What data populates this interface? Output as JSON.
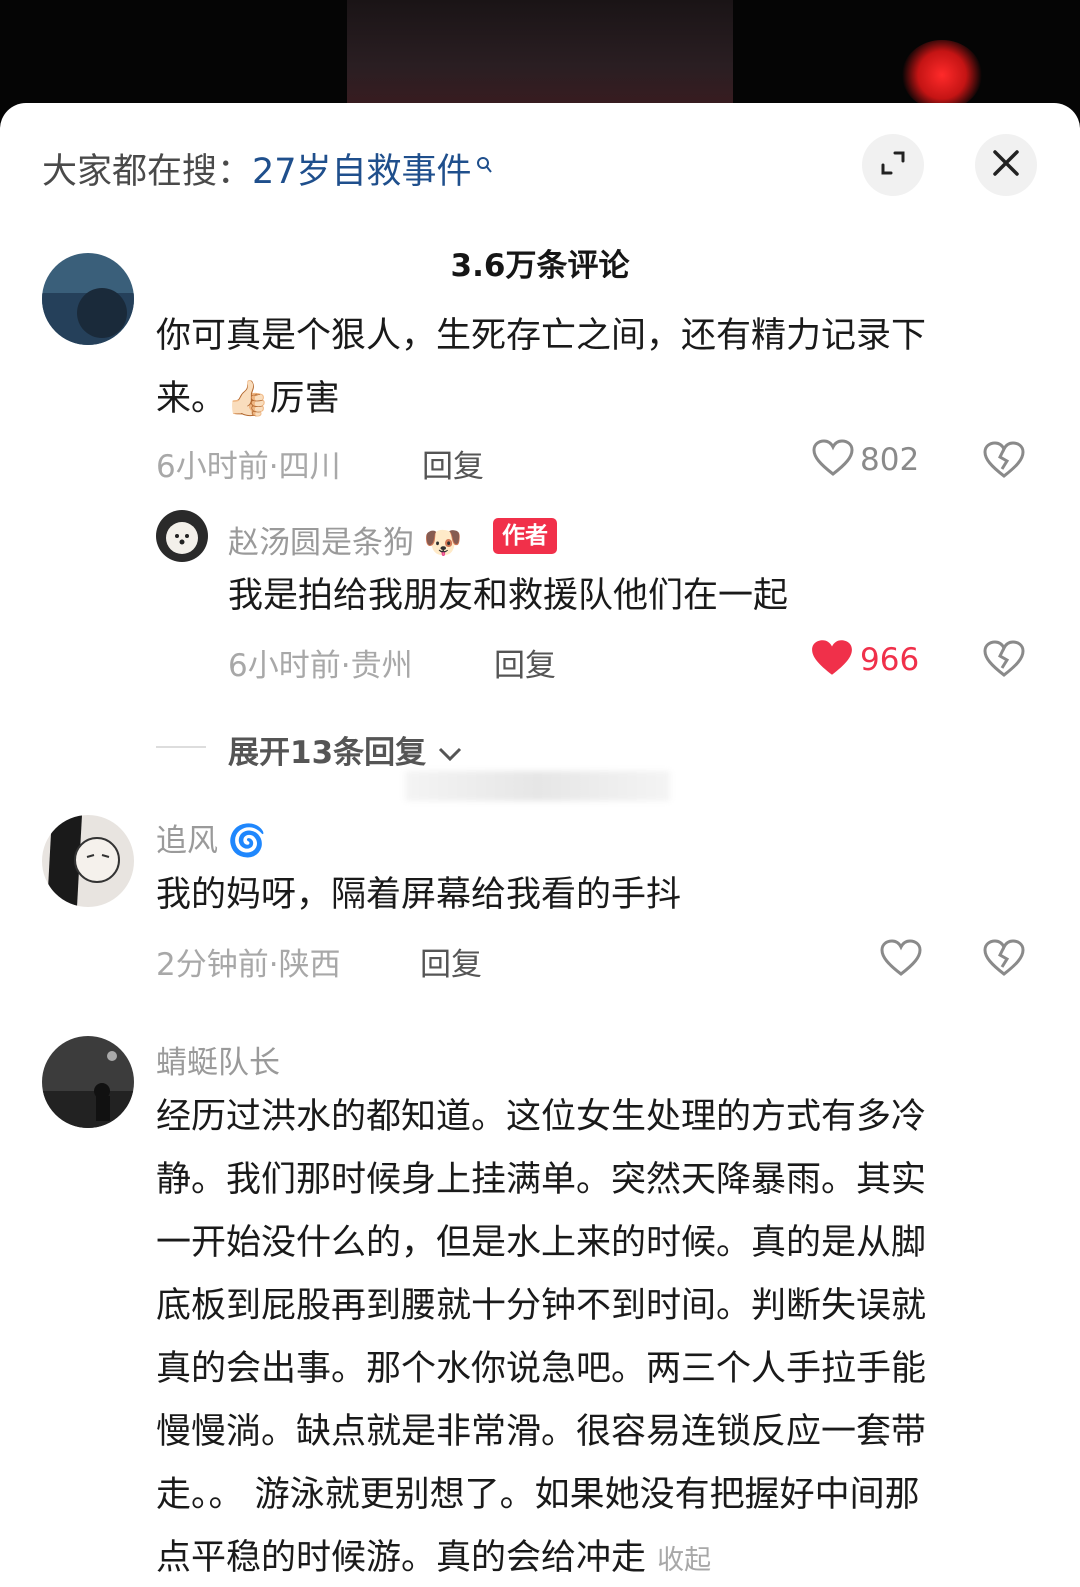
{
  "search": {
    "prefix": "大家都在搜：",
    "term": "27岁自救事件"
  },
  "header": {
    "comment_count": "3.6万条评论"
  },
  "comments": [
    {
      "text_line1": "你可真是个狠人，生死存亡之间，还有精力记录下",
      "text_line2_a": "来。",
      "text_line2_emoji": "👍🏻",
      "text_line2_b": "厉害",
      "time": "6小时前·四川",
      "reply_label": "回复",
      "likes": "802",
      "reply": {
        "name": "赵汤圆是条狗",
        "name_emoji": "🐶",
        "badge": "作者",
        "text": "我是拍给我朋友和救援队他们在一起",
        "time": "6小时前·贵州",
        "reply_label": "回复",
        "likes": "966"
      },
      "expand_label": "展开13条回复"
    },
    {
      "name": "追风",
      "name_emoji": "🌀",
      "text": "我的妈呀，隔着屏幕给我看的手抖",
      "time": "2分钟前·陕西",
      "reply_label": "回复"
    },
    {
      "name": "蜻蜓队长",
      "lines": [
        "经历过洪水的都知道。这位女生处理的方式有多冷",
        "静。我们那时候身上挂满单。突然天降暴雨。其实",
        "一开始没什么的，但是水上来的时候。真的是从脚",
        "底板到屁股再到腰就十分钟不到时间。判断失误就",
        "真的会出事。那个水你说急吧。两三个人手拉手能",
        "慢慢淌。缺点就是非常滑。很容易连锁反应一套带",
        "走。。 游泳就更别想了。如果她没有把握好中间那",
        "点平稳的时候游。真的会给冲走"
      ],
      "collapse_label": "收起"
    }
  ],
  "colors": {
    "accent_red": "#f0304a",
    "search_term_blue": "#1f4f8c"
  }
}
